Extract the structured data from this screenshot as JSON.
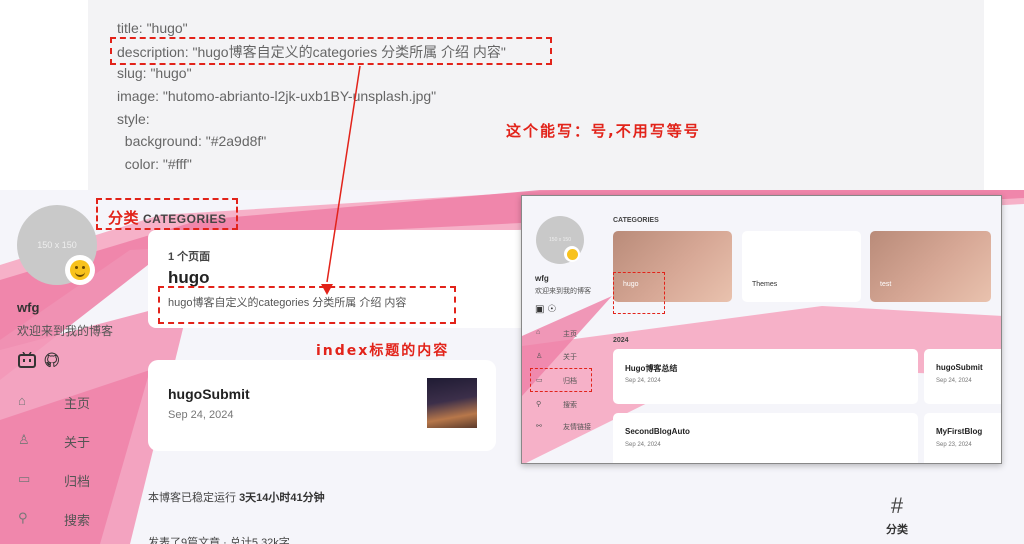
{
  "code": {
    "lines": [
      "title: \"hugo\"",
      "description: \"hugo博客自定义的categories 分类所属 介绍 内容\"",
      "slug: \"hugo\"",
      "image: \"hutomo-abrianto-l2jk-uxb1BY-unsplash.jpg\"",
      "style:",
      "  background: \"#2a9d8f\"",
      "  color: \"#fff\""
    ]
  },
  "annotations": {
    "colon_note": "这个能写：号,不用写等号",
    "index_note": "index标题的内容"
  },
  "blog": {
    "avatar_placeholder": "150 x 150",
    "site_name": "wfg",
    "site_desc": "欢迎来到我的博客",
    "social": [
      "bilibili-icon",
      "github-icon"
    ],
    "nav": [
      {
        "icon": "home-icon",
        "label": "主页"
      },
      {
        "icon": "user-icon",
        "label": "关于"
      },
      {
        "icon": "archive-icon",
        "label": "归档"
      },
      {
        "icon": "search-icon",
        "label": "搜索"
      }
    ],
    "category_header_zh": "分类",
    "category_header_en": "CATEGORIES",
    "category_card": {
      "count": "1 个页面",
      "title": "hugo",
      "description": "hugo博客自定义的categories 分类所属 介绍 内容"
    },
    "post_card": {
      "title": "hugoSubmit",
      "date": "Sep 24, 2024"
    },
    "footer_run_prefix": "本博客已稳定运行 ",
    "footer_run_value": "3天14小时41分钟",
    "footer_posts": "发表了9篇文章 · 总计5.32k字",
    "widget_hash": "#",
    "widget_label": "分类"
  },
  "overlay": {
    "avatar_placeholder": "150 x 150",
    "site_name": "wfg",
    "site_desc": "欢迎来到我的博客",
    "nav": [
      {
        "icon": "home-icon",
        "label": "主页"
      },
      {
        "icon": "user-icon",
        "label": "关于"
      },
      {
        "icon": "archive-icon",
        "label": "归档"
      },
      {
        "icon": "search-icon",
        "label": "搜索"
      },
      {
        "icon": "link-icon",
        "label": "友情链接"
      }
    ],
    "categories_header": "CATEGORIES",
    "tiles": [
      "hugo",
      "Themes",
      "test"
    ],
    "year": "2024",
    "posts": [
      {
        "title": "Hugo博客总结",
        "date": "Sep 24, 2024"
      },
      {
        "title": "hugoSubmit",
        "date": "Sep 24, 2024"
      },
      {
        "title": "SecondBlogAuto",
        "date": "Sep 24, 2024"
      },
      {
        "title": "MyFirstBlog",
        "date": "Sep 23, 2024"
      }
    ]
  },
  "colors": {
    "annotation_red": "#e2231a",
    "pink_primary": "#ef7fa6",
    "pink_light": "#f6b1c8",
    "page_bg": "#f5f5fa"
  }
}
